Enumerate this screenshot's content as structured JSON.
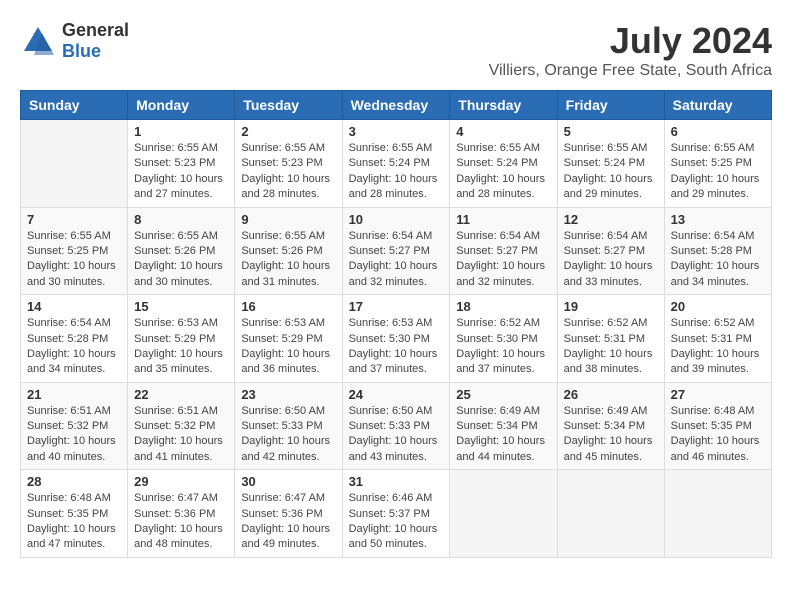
{
  "logo": {
    "general": "General",
    "blue": "Blue"
  },
  "title": "July 2024",
  "subtitle": "Villiers, Orange Free State, South Africa",
  "weekdays": [
    "Sunday",
    "Monday",
    "Tuesday",
    "Wednesday",
    "Thursday",
    "Friday",
    "Saturday"
  ],
  "weeks": [
    [
      {
        "day": "",
        "info": ""
      },
      {
        "day": "1",
        "info": "Sunrise: 6:55 AM\nSunset: 5:23 PM\nDaylight: 10 hours\nand 27 minutes."
      },
      {
        "day": "2",
        "info": "Sunrise: 6:55 AM\nSunset: 5:23 PM\nDaylight: 10 hours\nand 28 minutes."
      },
      {
        "day": "3",
        "info": "Sunrise: 6:55 AM\nSunset: 5:24 PM\nDaylight: 10 hours\nand 28 minutes."
      },
      {
        "day": "4",
        "info": "Sunrise: 6:55 AM\nSunset: 5:24 PM\nDaylight: 10 hours\nand 28 minutes."
      },
      {
        "day": "5",
        "info": "Sunrise: 6:55 AM\nSunset: 5:24 PM\nDaylight: 10 hours\nand 29 minutes."
      },
      {
        "day": "6",
        "info": "Sunrise: 6:55 AM\nSunset: 5:25 PM\nDaylight: 10 hours\nand 29 minutes."
      }
    ],
    [
      {
        "day": "7",
        "info": "Sunrise: 6:55 AM\nSunset: 5:25 PM\nDaylight: 10 hours\nand 30 minutes."
      },
      {
        "day": "8",
        "info": "Sunrise: 6:55 AM\nSunset: 5:26 PM\nDaylight: 10 hours\nand 30 minutes."
      },
      {
        "day": "9",
        "info": "Sunrise: 6:55 AM\nSunset: 5:26 PM\nDaylight: 10 hours\nand 31 minutes."
      },
      {
        "day": "10",
        "info": "Sunrise: 6:54 AM\nSunset: 5:27 PM\nDaylight: 10 hours\nand 32 minutes."
      },
      {
        "day": "11",
        "info": "Sunrise: 6:54 AM\nSunset: 5:27 PM\nDaylight: 10 hours\nand 32 minutes."
      },
      {
        "day": "12",
        "info": "Sunrise: 6:54 AM\nSunset: 5:27 PM\nDaylight: 10 hours\nand 33 minutes."
      },
      {
        "day": "13",
        "info": "Sunrise: 6:54 AM\nSunset: 5:28 PM\nDaylight: 10 hours\nand 34 minutes."
      }
    ],
    [
      {
        "day": "14",
        "info": "Sunrise: 6:54 AM\nSunset: 5:28 PM\nDaylight: 10 hours\nand 34 minutes."
      },
      {
        "day": "15",
        "info": "Sunrise: 6:53 AM\nSunset: 5:29 PM\nDaylight: 10 hours\nand 35 minutes."
      },
      {
        "day": "16",
        "info": "Sunrise: 6:53 AM\nSunset: 5:29 PM\nDaylight: 10 hours\nand 36 minutes."
      },
      {
        "day": "17",
        "info": "Sunrise: 6:53 AM\nSunset: 5:30 PM\nDaylight: 10 hours\nand 37 minutes."
      },
      {
        "day": "18",
        "info": "Sunrise: 6:52 AM\nSunset: 5:30 PM\nDaylight: 10 hours\nand 37 minutes."
      },
      {
        "day": "19",
        "info": "Sunrise: 6:52 AM\nSunset: 5:31 PM\nDaylight: 10 hours\nand 38 minutes."
      },
      {
        "day": "20",
        "info": "Sunrise: 6:52 AM\nSunset: 5:31 PM\nDaylight: 10 hours\nand 39 minutes."
      }
    ],
    [
      {
        "day": "21",
        "info": "Sunrise: 6:51 AM\nSunset: 5:32 PM\nDaylight: 10 hours\nand 40 minutes."
      },
      {
        "day": "22",
        "info": "Sunrise: 6:51 AM\nSunset: 5:32 PM\nDaylight: 10 hours\nand 41 minutes."
      },
      {
        "day": "23",
        "info": "Sunrise: 6:50 AM\nSunset: 5:33 PM\nDaylight: 10 hours\nand 42 minutes."
      },
      {
        "day": "24",
        "info": "Sunrise: 6:50 AM\nSunset: 5:33 PM\nDaylight: 10 hours\nand 43 minutes."
      },
      {
        "day": "25",
        "info": "Sunrise: 6:49 AM\nSunset: 5:34 PM\nDaylight: 10 hours\nand 44 minutes."
      },
      {
        "day": "26",
        "info": "Sunrise: 6:49 AM\nSunset: 5:34 PM\nDaylight: 10 hours\nand 45 minutes."
      },
      {
        "day": "27",
        "info": "Sunrise: 6:48 AM\nSunset: 5:35 PM\nDaylight: 10 hours\nand 46 minutes."
      }
    ],
    [
      {
        "day": "28",
        "info": "Sunrise: 6:48 AM\nSunset: 5:35 PM\nDaylight: 10 hours\nand 47 minutes."
      },
      {
        "day": "29",
        "info": "Sunrise: 6:47 AM\nSunset: 5:36 PM\nDaylight: 10 hours\nand 48 minutes."
      },
      {
        "day": "30",
        "info": "Sunrise: 6:47 AM\nSunset: 5:36 PM\nDaylight: 10 hours\nand 49 minutes."
      },
      {
        "day": "31",
        "info": "Sunrise: 6:46 AM\nSunset: 5:37 PM\nDaylight: 10 hours\nand 50 minutes."
      },
      {
        "day": "",
        "info": ""
      },
      {
        "day": "",
        "info": ""
      },
      {
        "day": "",
        "info": ""
      }
    ]
  ]
}
